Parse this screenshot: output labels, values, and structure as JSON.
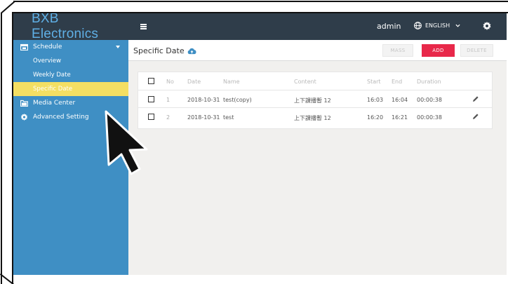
{
  "sidebar": {
    "brand": "BXB Electronics",
    "items": [
      {
        "label": "Schedule",
        "icon": "calendar-icon"
      },
      {
        "label": "Media Center",
        "icon": "folder-icon"
      },
      {
        "label": "Advanced Setting",
        "icon": "gear-icon"
      }
    ],
    "schedule_sub": [
      "Overview",
      "Weekly Date",
      "Specific Date"
    ],
    "active": "Specific Date"
  },
  "topbar": {
    "menu_icon": "hamburger-icon",
    "user": "admin",
    "language": "ENGLISH",
    "settings_icon": "gear-icon"
  },
  "page": {
    "title": "Specific Date",
    "title_icon": "cloud-upload-icon",
    "buttons": {
      "mass": "MASS",
      "add": "ADD",
      "delete": "DELETE"
    }
  },
  "table": {
    "columns": [
      "No",
      "Date",
      "Name",
      "Content",
      "Start",
      "End",
      "Duration"
    ],
    "rows": [
      {
        "no": "1",
        "date": "2018-10-31",
        "name": "test(copy)",
        "content": "上下課播暫 12",
        "start": "16:03",
        "end": "16:04",
        "duration": "00:00:38"
      },
      {
        "no": "2",
        "date": "2018-10-31",
        "name": "test",
        "content": "上下課播暫 12",
        "start": "16:20",
        "end": "16:21",
        "duration": "00:00:38"
      }
    ]
  },
  "colors": {
    "sidebar": "#3f8fc4",
    "topbar": "#2f3d4a",
    "brand": "#5fb0e6",
    "active_item": "#f4df63",
    "add_button": "#e8284a"
  }
}
